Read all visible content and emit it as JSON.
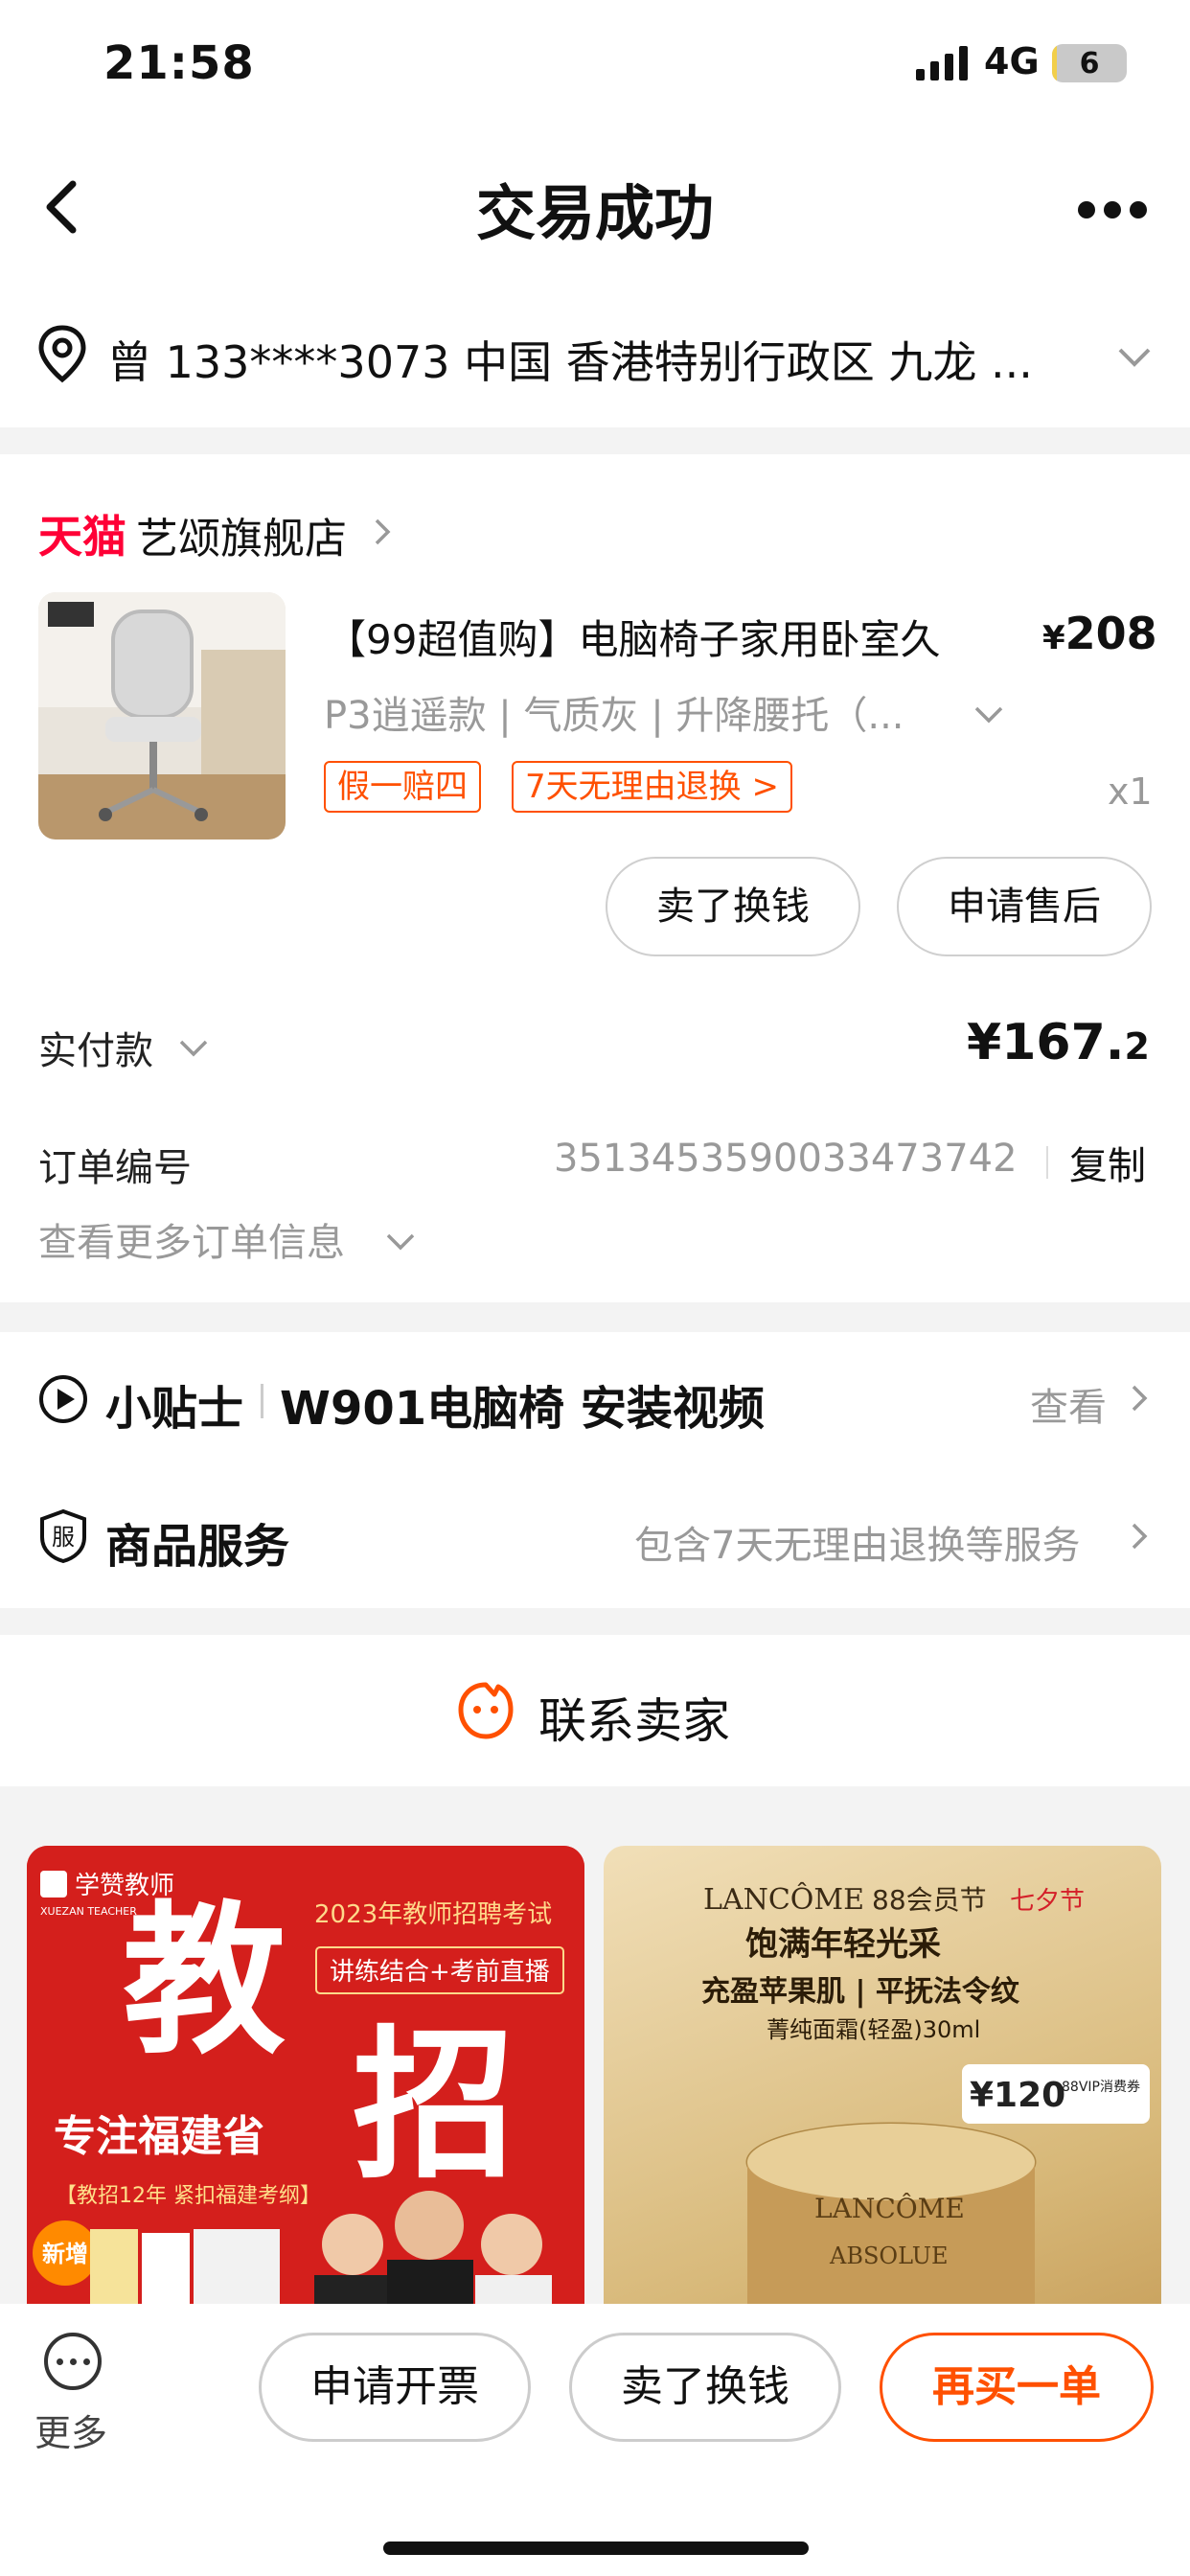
{
  "status_bar": {
    "time": "21:58",
    "network": "4G",
    "battery": "6",
    "battery_level_percent": 6
  },
  "nav": {
    "title": "交易成功"
  },
  "address": {
    "text": "曾 133****3073 中国 香港特别行政区 九龙 ..."
  },
  "order": {
    "store_brand": "天猫",
    "store_name": "艺颂旗舰店",
    "product_title": "【99超值购】电脑椅子家用卧室久",
    "price_currency": "¥",
    "price": "208",
    "sku": "P3逍遥款 | 气质灰 | 升降腰托（...",
    "tags": [
      "假一赔四",
      "7天无理由退换 >"
    ],
    "quantity": "x1",
    "actions": [
      "卖了换钱",
      "申请售后"
    ],
    "paid_label": "实付款",
    "paid_currency": "¥",
    "paid_amount_int": "167.",
    "paid_amount_dec": "2",
    "order_no_label": "订单编号",
    "order_no": "3513453590033473742",
    "copy_label": "复制",
    "more_info_label": "查看更多订单信息"
  },
  "tips": {
    "label": "小贴士",
    "text": "W901电脑椅 安装视频",
    "view_label": "查看"
  },
  "service": {
    "label": "商品服务",
    "text": "包含7天无理由退换等服务"
  },
  "contact": {
    "label": "联系卖家"
  },
  "ads": {
    "left": {
      "brand": "学赞教师",
      "brand_en": "XUEZAN TEACHER",
      "year_text": "2023年教师招聘考试",
      "badge": "讲练结合+考前直播",
      "big1": "教",
      "big2": "招",
      "focus": "专注福建省",
      "sub": "【教招12年 紧扣福建考纲】",
      "new_badge": "新增"
    },
    "right": {
      "brand": "LANCÔME",
      "event": "88会员节",
      "festival": "七夕节",
      "line1": "饱满年轻光采",
      "line2": "充盈苹果肌 | 平抚法令纹",
      "line3": "菁纯面霜(轻盈)30ml",
      "coupon": "¥120",
      "coupon_note": "88VIP消费券",
      "jar_brand": "LANCÔME",
      "jar_name": "ABSOLUE"
    }
  },
  "bottom_bar": {
    "more_label": "更多",
    "buttons": [
      "申请开票",
      "卖了换钱",
      "再买一单"
    ]
  },
  "colors": {
    "accent": "#ff5000",
    "tmall": "#ff0036",
    "muted": "#999999",
    "background": "#f3f3f3"
  }
}
